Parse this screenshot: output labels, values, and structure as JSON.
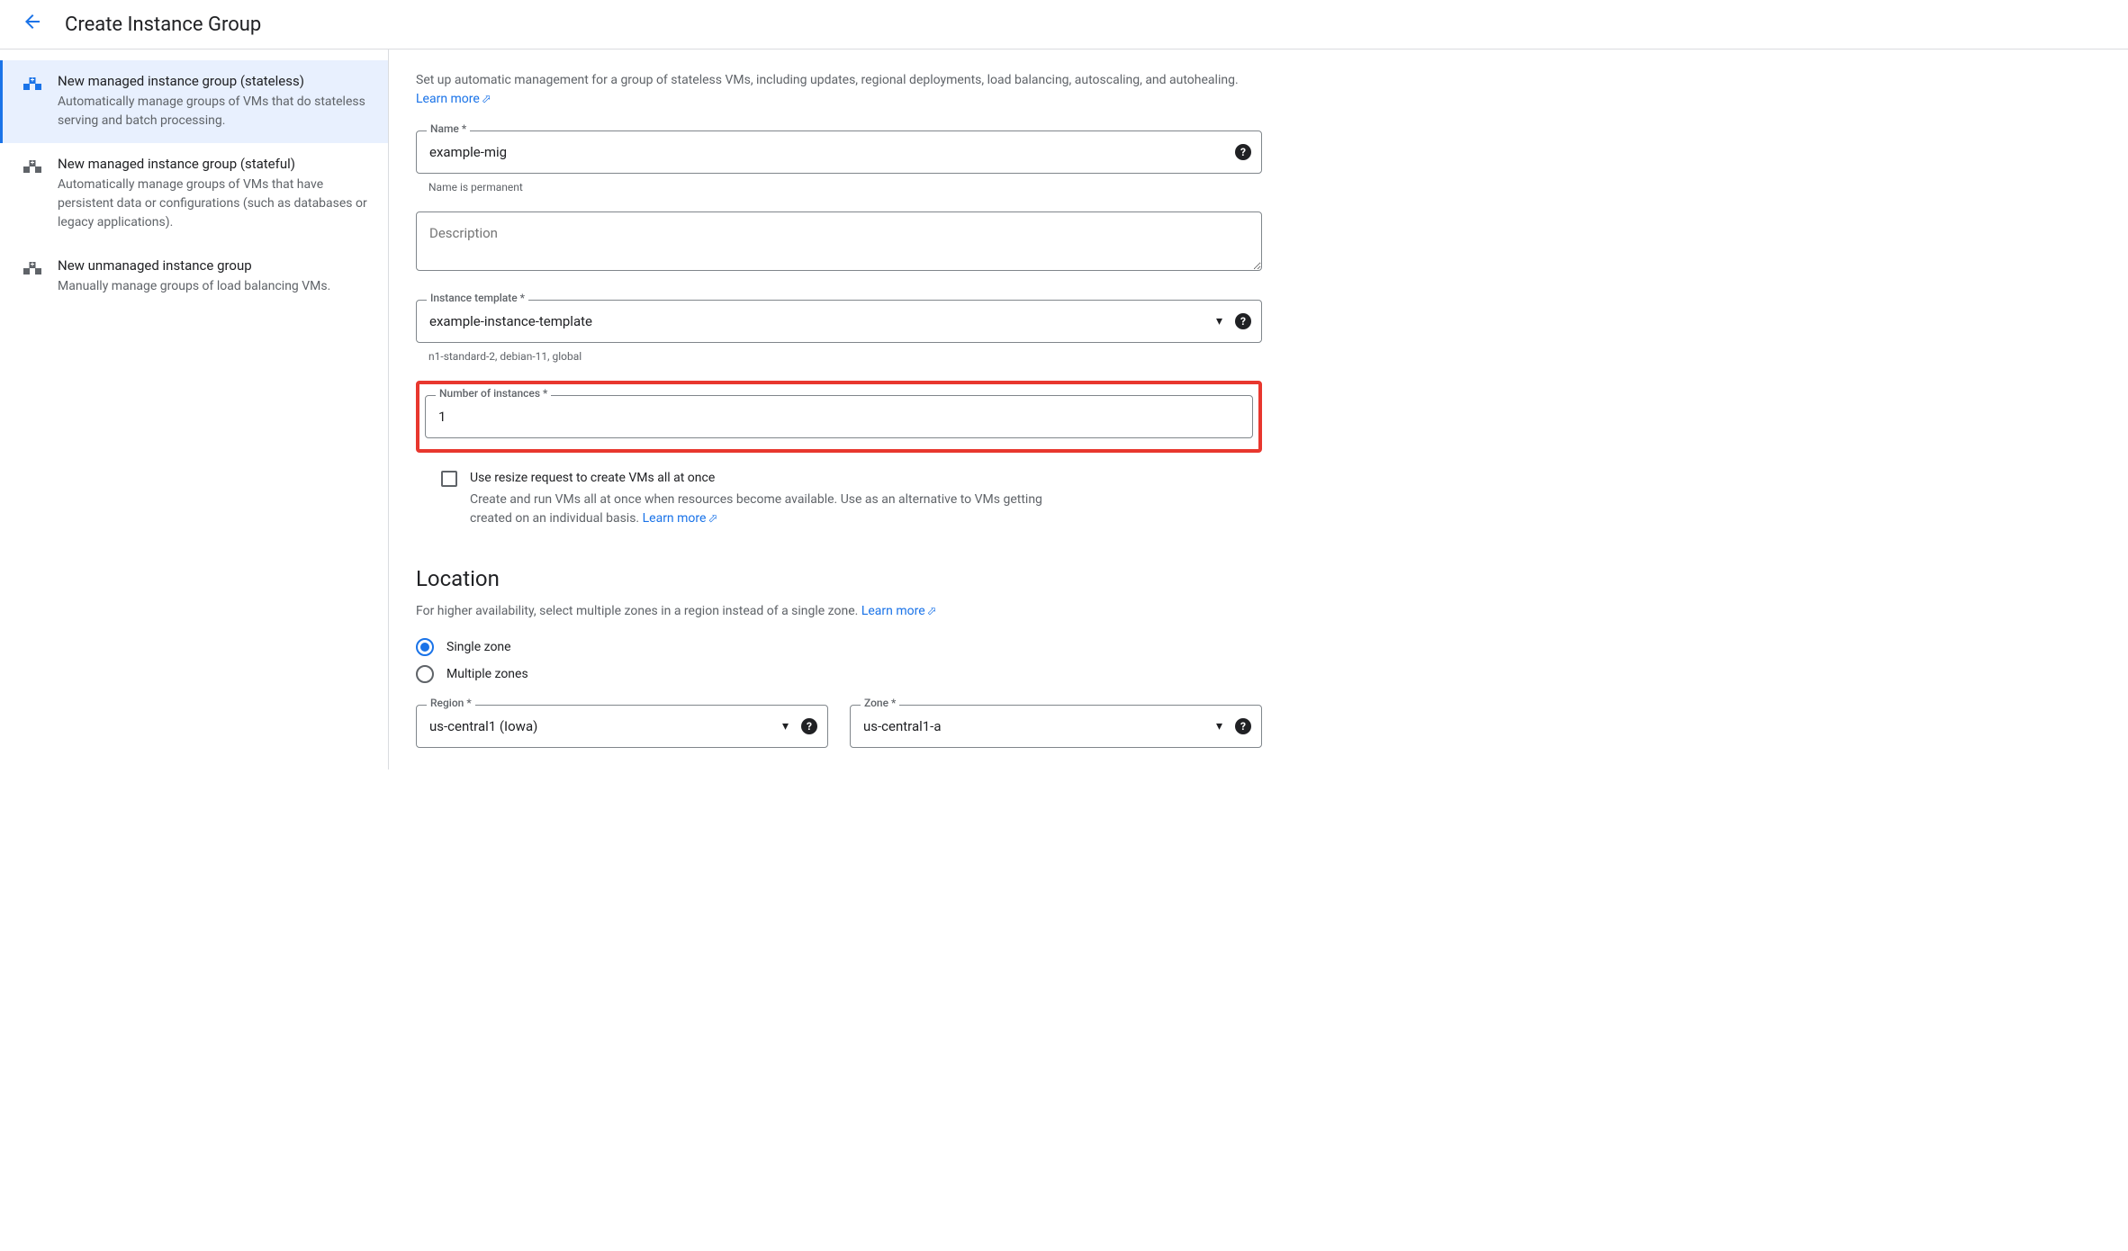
{
  "header": {
    "title": "Create Instance Group"
  },
  "sidebar": {
    "items": [
      {
        "title": "New managed instance group (stateless)",
        "desc": "Automatically manage groups of VMs that do stateless serving and batch processing."
      },
      {
        "title": "New managed instance group (stateful)",
        "desc": "Automatically manage groups of VMs that have persistent data or configurations (such as databases or legacy applications)."
      },
      {
        "title": "New unmanaged instance group",
        "desc": "Manually manage groups of load balancing VMs."
      }
    ]
  },
  "main": {
    "intro": "Set up automatic management for a group of stateless VMs, including updates, regional deployments, load balancing, autoscaling, and autohealing.",
    "learn_more": "Learn more",
    "fields": {
      "name": {
        "label": "Name *",
        "value": "example-mig",
        "helper": "Name is permanent"
      },
      "description": {
        "placeholder": "Description"
      },
      "instance_template": {
        "label": "Instance template *",
        "value": "example-instance-template",
        "helper": "n1-standard-2, debian-11, global"
      },
      "num_instances": {
        "label": "Number of instances *",
        "value": "1"
      },
      "resize_request": {
        "label": "Use resize request to create VMs all at once",
        "desc": "Create and run VMs all at once when resources become available. Use as an alternative to VMs getting created on an individual basis."
      }
    },
    "location": {
      "title": "Location",
      "desc": "For higher availability, select multiple zones in a region instead of a single zone.",
      "options": {
        "single": "Single zone",
        "multiple": "Multiple zones"
      },
      "region": {
        "label": "Region *",
        "value": "us-central1 (Iowa)"
      },
      "zone": {
        "label": "Zone *",
        "value": "us-central1-a"
      }
    }
  }
}
